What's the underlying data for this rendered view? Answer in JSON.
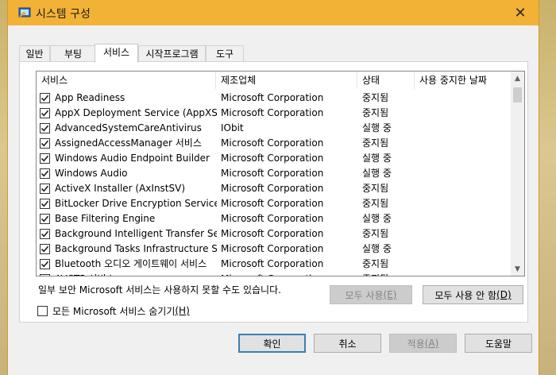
{
  "window": {
    "title": "시스템 구성",
    "close_glyph": "✕"
  },
  "tabs": [
    {
      "label": "일반"
    },
    {
      "label": "부팅"
    },
    {
      "label": "서비스",
      "active": true
    },
    {
      "label": "시작프로그램"
    },
    {
      "label": "도구"
    }
  ],
  "services": {
    "columns": {
      "name": "서비스",
      "manufacturer": "제조업체",
      "status": "상태",
      "disabled_date": "사용 중지한 날짜"
    },
    "rows": [
      {
        "checked": true,
        "name": "App Readiness",
        "manufacturer": "Microsoft Corporation",
        "status": "중지됨"
      },
      {
        "checked": true,
        "name": "AppX Deployment Service (AppXSV",
        "manufacturer": "Microsoft Corporation",
        "status": "중지됨"
      },
      {
        "checked": true,
        "name": "AdvancedSystemCareAntivirus",
        "manufacturer": "IObit",
        "status": "실행 중"
      },
      {
        "checked": true,
        "name": "AssignedAccessManager 서비스",
        "manufacturer": "Microsoft Corporation",
        "status": "중지됨"
      },
      {
        "checked": true,
        "name": "Windows Audio Endpoint Builder",
        "manufacturer": "Microsoft Corporation",
        "status": "실행 중"
      },
      {
        "checked": true,
        "name": "Windows Audio",
        "manufacturer": "Microsoft Corporation",
        "status": "실행 중"
      },
      {
        "checked": true,
        "name": "ActiveX Installer (AxInstSV)",
        "manufacturer": "Microsoft Corporation",
        "status": "중지됨"
      },
      {
        "checked": true,
        "name": "BitLocker Drive Encryption Service",
        "manufacturer": "Microsoft Corporation",
        "status": "중지됨"
      },
      {
        "checked": true,
        "name": "Base Filtering Engine",
        "manufacturer": "Microsoft Corporation",
        "status": "실행 중"
      },
      {
        "checked": true,
        "name": "Background Intelligent Transfer Ser...",
        "manufacturer": "Microsoft Corporation",
        "status": "중지됨"
      },
      {
        "checked": true,
        "name": "Background Tasks Infrastructure Ser...",
        "manufacturer": "Microsoft Corporation",
        "status": "실행 중"
      },
      {
        "checked": true,
        "name": "Bluetooth 오디오 게이트웨이 서비스",
        "manufacturer": "Microsoft Corporation",
        "status": "중지됨"
      },
      {
        "checked": true,
        "name": "AVCTP 서비스",
        "manufacturer": "Microsoft Corporation",
        "status": "중지됨"
      }
    ],
    "scroll_up_glyph": "▲",
    "scroll_down_glyph": "▼"
  },
  "notice": "일부 보안 Microsoft 서비스는 사용하지 못할 수도 있습니다.",
  "buttons": {
    "enable_all": {
      "label": "모두 사용",
      "accel": "(E)",
      "disabled": true
    },
    "disable_all": {
      "label": "모두 사용 안 함",
      "accel": "(D)"
    },
    "ok": {
      "label": "확인"
    },
    "cancel": {
      "label": "취소"
    },
    "apply": {
      "label": "적용",
      "accel": "(A)",
      "disabled": true
    },
    "help": {
      "label": "도움말"
    }
  },
  "hide_ms": {
    "label": "모든 Microsoft 서비스 숨기기",
    "accel": "(H)",
    "checked": false
  }
}
